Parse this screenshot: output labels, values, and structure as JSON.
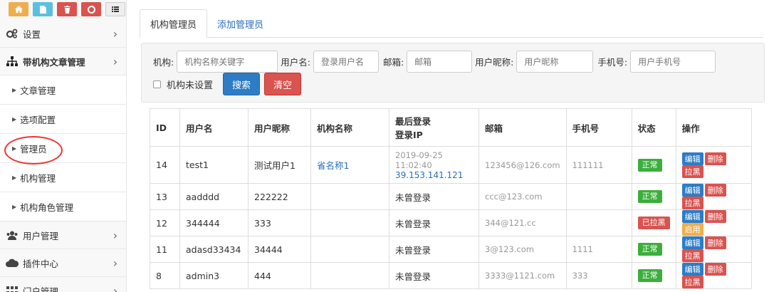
{
  "sidebar": {
    "items": [
      {
        "label": "设置",
        "icon": "gears-icon"
      },
      {
        "label": "带机构文章管理",
        "icon": "sitemap-icon"
      },
      {
        "label": "文章管理"
      },
      {
        "label": "选项配置"
      },
      {
        "label": "管理员"
      },
      {
        "label": "机构管理"
      },
      {
        "label": "机构角色管理"
      },
      {
        "label": "用户管理",
        "icon": "users-icon"
      },
      {
        "label": "插件中心",
        "icon": "cloud-icon"
      },
      {
        "label": "门户管理",
        "icon": "grid-icon"
      }
    ]
  },
  "tabs": [
    {
      "label": "机构管理员"
    },
    {
      "label": "添加管理员"
    }
  ],
  "search": {
    "org_label": "机构:",
    "org_placeholder": "机构名称关键字",
    "user_label": "用户名:",
    "user_placeholder": "登录用户名",
    "email_label": "邮箱:",
    "email_placeholder": "邮箱",
    "nick_label": "用户昵称:",
    "nick_placeholder": "用户昵称",
    "phone_label": "手机号:",
    "phone_placeholder": "用户手机号",
    "unset_label": "机构未设置",
    "search_btn": "搜索",
    "clear_btn": "清空"
  },
  "table": {
    "headers": [
      "ID",
      "用户名",
      "用户昵称",
      "机构名称",
      "最后登录",
      "登录IP",
      "邮箱",
      "手机号",
      "状态",
      "操作"
    ],
    "actions": {
      "edit": "编辑",
      "delete": "删除",
      "block": "拉黑",
      "enable": "启用"
    },
    "rows": [
      {
        "id": "14",
        "user": "test1",
        "nick": "测试用户1",
        "org": "省名称1",
        "login": "2019-09-25 11:02:40",
        "ip": "39.153.141.121",
        "email": "123456@126.com",
        "phone": "111111",
        "status": "正常"
      },
      {
        "id": "13",
        "user": "aadddd",
        "nick": "222222",
        "org": "",
        "login": "未曾登录",
        "ip": "",
        "email": "ccc@123.com",
        "phone": "",
        "status": "正常"
      },
      {
        "id": "12",
        "user": "344444",
        "nick": "333",
        "org": "",
        "login": "未曾登录",
        "ip": "",
        "email": "344@121.cc",
        "phone": "",
        "status": "已拉黑"
      },
      {
        "id": "11",
        "user": "adasd33434",
        "nick": "34444",
        "org": "",
        "login": "未曾登录",
        "ip": "",
        "email": "3@123.com",
        "phone": "1111",
        "status": "正常"
      },
      {
        "id": "8",
        "user": "admin3",
        "nick": "444",
        "org": "",
        "login": "未曾登录",
        "ip": "",
        "email": "3333@1121.com",
        "phone": "333",
        "status": "正常"
      }
    ]
  }
}
